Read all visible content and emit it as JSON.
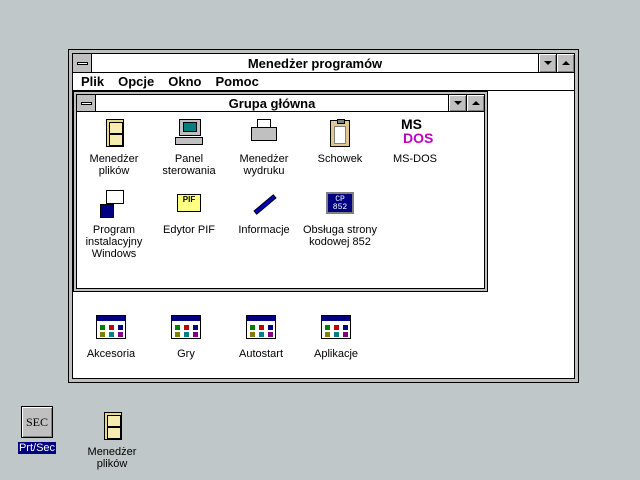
{
  "program_manager": {
    "title": "Menedżer programów",
    "menu": [
      "Plik",
      "Opcje",
      "Okno",
      "Pomoc"
    ]
  },
  "group_window": {
    "title": "Grupa główna",
    "icons": [
      {
        "label": "Menedżer plików",
        "icon": "file-cabinet-icon"
      },
      {
        "label": "Panel sterowania",
        "icon": "control-panel-icon"
      },
      {
        "label": "Menedżer wydruku",
        "icon": "printer-icon"
      },
      {
        "label": "Schowek",
        "icon": "clipboard-icon"
      },
      {
        "label": "MS-DOS",
        "icon": "msdos-icon"
      },
      {
        "label": "Program instalacyjny Windows",
        "icon": "setup-icon"
      },
      {
        "label": "Edytor PIF",
        "icon": "pif-icon"
      },
      {
        "label": "Informacje",
        "icon": "pen-icon"
      },
      {
        "label": "Obsługa strony kodowej 852",
        "icon": "codepage-icon"
      }
    ],
    "codepage_text": "CP 852",
    "pif_text": "PIF",
    "ms_text": "MS",
    "dos_text": "DOS"
  },
  "minimized_groups": [
    {
      "label": "Akcesoria"
    },
    {
      "label": "Gry"
    },
    {
      "label": "Autostart"
    },
    {
      "label": "Aplikacje"
    }
  ],
  "desktop_icons": [
    {
      "label": "Prt/Sec",
      "glyph": "SEC",
      "selected": true
    },
    {
      "label": "Menedżer plików"
    }
  ]
}
